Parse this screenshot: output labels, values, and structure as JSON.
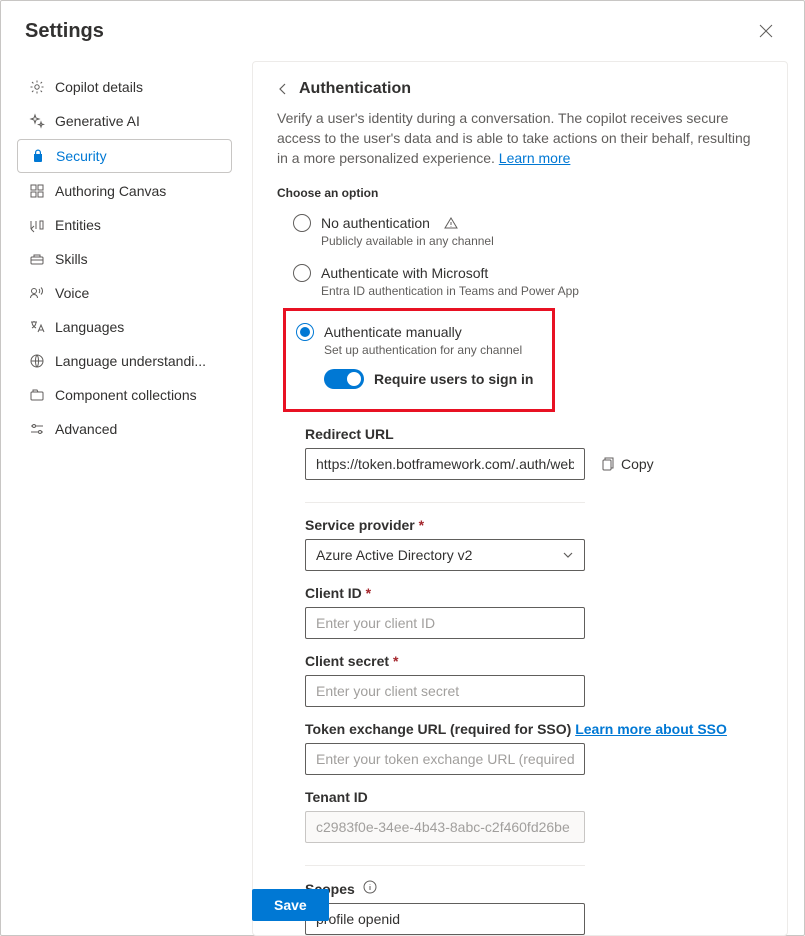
{
  "header": {
    "title": "Settings"
  },
  "sidebar": {
    "items": [
      {
        "label": "Copilot details"
      },
      {
        "label": "Generative AI"
      },
      {
        "label": "Security"
      },
      {
        "label": "Authoring Canvas"
      },
      {
        "label": "Entities"
      },
      {
        "label": "Skills"
      },
      {
        "label": "Voice"
      },
      {
        "label": "Languages"
      },
      {
        "label": "Language understandi..."
      },
      {
        "label": "Component collections"
      },
      {
        "label": "Advanced"
      }
    ]
  },
  "main": {
    "title": "Authentication",
    "description": "Verify a user's identity during a conversation. The copilot receives secure access to the user's data and is able to take actions on their behalf, resulting in a more personalized experience. ",
    "learn_more": "Learn more",
    "choose_label": "Choose an option",
    "options": {
      "none": {
        "label": "No authentication",
        "sub": "Publicly available in any channel"
      },
      "ms": {
        "label": "Authenticate with Microsoft",
        "sub": "Entra ID authentication in Teams and Power App"
      },
      "manual": {
        "label": "Authenticate manually",
        "sub": "Set up authentication for any channel"
      }
    },
    "toggle": {
      "label": "Require users to sign in"
    },
    "redirect": {
      "label": "Redirect URL",
      "value": "https://token.botframework.com/.auth/web/re",
      "copy_label": "Copy"
    },
    "provider": {
      "label": "Service provider",
      "value": "Azure Active Directory v2"
    },
    "client_id": {
      "label": "Client ID",
      "placeholder": "Enter your client ID"
    },
    "client_secret": {
      "label": "Client secret",
      "placeholder": "Enter your client secret"
    },
    "token_url": {
      "label": "Token exchange URL (required for SSO) ",
      "link": "Learn more about SSO",
      "placeholder": "Enter your token exchange URL (required for S"
    },
    "tenant": {
      "label": "Tenant ID",
      "value": "c2983f0e-34ee-4b43-8abc-c2f460fd26be"
    },
    "scopes": {
      "label": "Scopes",
      "value": "profile openid"
    }
  },
  "footer": {
    "save": "Save"
  }
}
